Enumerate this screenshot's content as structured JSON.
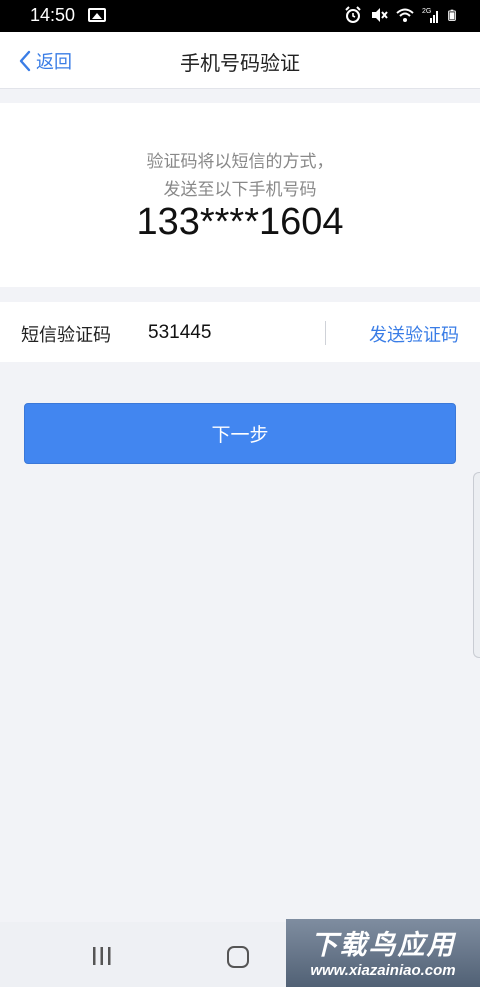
{
  "status_bar": {
    "time": "14:50",
    "icons": [
      "image-icon",
      "alarm-icon",
      "mute-icon",
      "wifi-icon",
      "signal-icon",
      "battery-icon"
    ],
    "network_label": "2G"
  },
  "nav": {
    "back_label": "返回",
    "title": "手机号码验证"
  },
  "info": {
    "line1": "验证码将以短信的方式，",
    "line2": "发送至以下手机号码",
    "phone": "133****1604"
  },
  "sms": {
    "label": "短信验证码",
    "value": "531445",
    "send_label": "发送验证码"
  },
  "next_button": {
    "label": "下一步"
  },
  "watermark": {
    "title": "下载鸟应用",
    "url": "www.xiazainiao.com"
  },
  "colors": {
    "accent": "#3a7de6",
    "button": "#4286f0",
    "background": "#f2f3f7"
  }
}
